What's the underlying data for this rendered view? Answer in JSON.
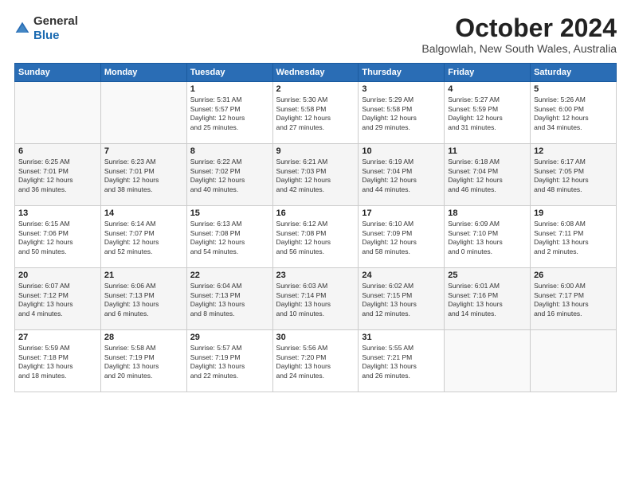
{
  "header": {
    "logo_general": "General",
    "logo_blue": "Blue",
    "month": "October 2024",
    "location": "Balgowlah, New South Wales, Australia"
  },
  "weekdays": [
    "Sunday",
    "Monday",
    "Tuesday",
    "Wednesday",
    "Thursday",
    "Friday",
    "Saturday"
  ],
  "weeks": [
    [
      {
        "day": "",
        "content": ""
      },
      {
        "day": "",
        "content": ""
      },
      {
        "day": "1",
        "content": "Sunrise: 5:31 AM\nSunset: 5:57 PM\nDaylight: 12 hours\nand 25 minutes."
      },
      {
        "day": "2",
        "content": "Sunrise: 5:30 AM\nSunset: 5:58 PM\nDaylight: 12 hours\nand 27 minutes."
      },
      {
        "day": "3",
        "content": "Sunrise: 5:29 AM\nSunset: 5:58 PM\nDaylight: 12 hours\nand 29 minutes."
      },
      {
        "day": "4",
        "content": "Sunrise: 5:27 AM\nSunset: 5:59 PM\nDaylight: 12 hours\nand 31 minutes."
      },
      {
        "day": "5",
        "content": "Sunrise: 5:26 AM\nSunset: 6:00 PM\nDaylight: 12 hours\nand 34 minutes."
      }
    ],
    [
      {
        "day": "6",
        "content": "Sunrise: 6:25 AM\nSunset: 7:01 PM\nDaylight: 12 hours\nand 36 minutes."
      },
      {
        "day": "7",
        "content": "Sunrise: 6:23 AM\nSunset: 7:01 PM\nDaylight: 12 hours\nand 38 minutes."
      },
      {
        "day": "8",
        "content": "Sunrise: 6:22 AM\nSunset: 7:02 PM\nDaylight: 12 hours\nand 40 minutes."
      },
      {
        "day": "9",
        "content": "Sunrise: 6:21 AM\nSunset: 7:03 PM\nDaylight: 12 hours\nand 42 minutes."
      },
      {
        "day": "10",
        "content": "Sunrise: 6:19 AM\nSunset: 7:04 PM\nDaylight: 12 hours\nand 44 minutes."
      },
      {
        "day": "11",
        "content": "Sunrise: 6:18 AM\nSunset: 7:04 PM\nDaylight: 12 hours\nand 46 minutes."
      },
      {
        "day": "12",
        "content": "Sunrise: 6:17 AM\nSunset: 7:05 PM\nDaylight: 12 hours\nand 48 minutes."
      }
    ],
    [
      {
        "day": "13",
        "content": "Sunrise: 6:15 AM\nSunset: 7:06 PM\nDaylight: 12 hours\nand 50 minutes."
      },
      {
        "day": "14",
        "content": "Sunrise: 6:14 AM\nSunset: 7:07 PM\nDaylight: 12 hours\nand 52 minutes."
      },
      {
        "day": "15",
        "content": "Sunrise: 6:13 AM\nSunset: 7:08 PM\nDaylight: 12 hours\nand 54 minutes."
      },
      {
        "day": "16",
        "content": "Sunrise: 6:12 AM\nSunset: 7:08 PM\nDaylight: 12 hours\nand 56 minutes."
      },
      {
        "day": "17",
        "content": "Sunrise: 6:10 AM\nSunset: 7:09 PM\nDaylight: 12 hours\nand 58 minutes."
      },
      {
        "day": "18",
        "content": "Sunrise: 6:09 AM\nSunset: 7:10 PM\nDaylight: 13 hours\nand 0 minutes."
      },
      {
        "day": "19",
        "content": "Sunrise: 6:08 AM\nSunset: 7:11 PM\nDaylight: 13 hours\nand 2 minutes."
      }
    ],
    [
      {
        "day": "20",
        "content": "Sunrise: 6:07 AM\nSunset: 7:12 PM\nDaylight: 13 hours\nand 4 minutes."
      },
      {
        "day": "21",
        "content": "Sunrise: 6:06 AM\nSunset: 7:13 PM\nDaylight: 13 hours\nand 6 minutes."
      },
      {
        "day": "22",
        "content": "Sunrise: 6:04 AM\nSunset: 7:13 PM\nDaylight: 13 hours\nand 8 minutes."
      },
      {
        "day": "23",
        "content": "Sunrise: 6:03 AM\nSunset: 7:14 PM\nDaylight: 13 hours\nand 10 minutes."
      },
      {
        "day": "24",
        "content": "Sunrise: 6:02 AM\nSunset: 7:15 PM\nDaylight: 13 hours\nand 12 minutes."
      },
      {
        "day": "25",
        "content": "Sunrise: 6:01 AM\nSunset: 7:16 PM\nDaylight: 13 hours\nand 14 minutes."
      },
      {
        "day": "26",
        "content": "Sunrise: 6:00 AM\nSunset: 7:17 PM\nDaylight: 13 hours\nand 16 minutes."
      }
    ],
    [
      {
        "day": "27",
        "content": "Sunrise: 5:59 AM\nSunset: 7:18 PM\nDaylight: 13 hours\nand 18 minutes."
      },
      {
        "day": "28",
        "content": "Sunrise: 5:58 AM\nSunset: 7:19 PM\nDaylight: 13 hours\nand 20 minutes."
      },
      {
        "day": "29",
        "content": "Sunrise: 5:57 AM\nSunset: 7:19 PM\nDaylight: 13 hours\nand 22 minutes."
      },
      {
        "day": "30",
        "content": "Sunrise: 5:56 AM\nSunset: 7:20 PM\nDaylight: 13 hours\nand 24 minutes."
      },
      {
        "day": "31",
        "content": "Sunrise: 5:55 AM\nSunset: 7:21 PM\nDaylight: 13 hours\nand 26 minutes."
      },
      {
        "day": "",
        "content": ""
      },
      {
        "day": "",
        "content": ""
      }
    ]
  ]
}
